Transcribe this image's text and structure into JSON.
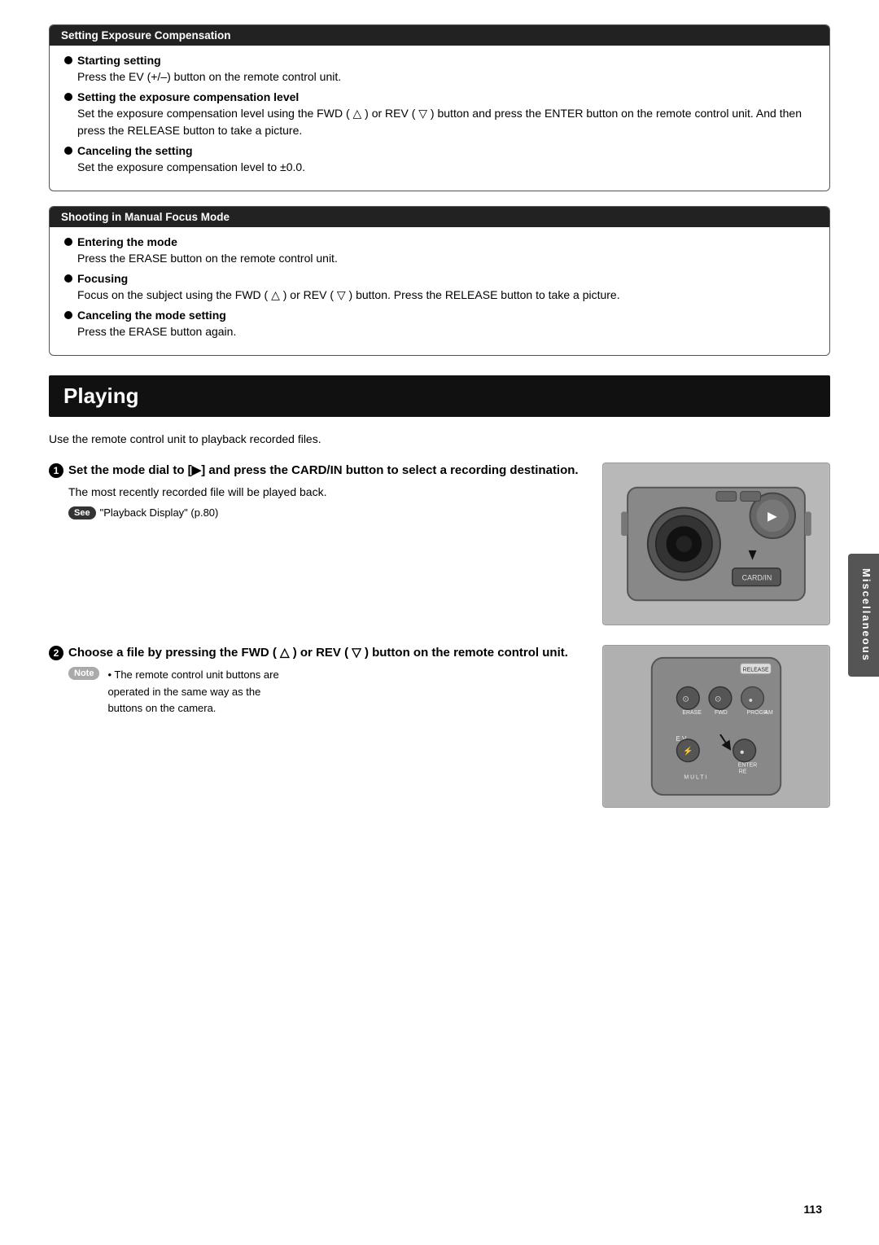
{
  "section1": {
    "title": "Setting Exposure Compensation",
    "bullets": [
      {
        "label": "Starting setting",
        "text": "Press the EV (+/–) button on the remote control unit."
      },
      {
        "label": "Setting the exposure compensation level",
        "text": "Set the exposure compensation level using the FWD ( △ ) or REV ( ▽ ) button and press the ENTER button on the remote control unit. And then press the RELEASE button to take a picture."
      },
      {
        "label": "Canceling the setting",
        "text": "Set the exposure compensation level to ±0.0."
      }
    ]
  },
  "section2": {
    "title": "Shooting in Manual Focus Mode",
    "bullets": [
      {
        "label": "Entering the mode",
        "text": "Press the ERASE button on the remote control unit."
      },
      {
        "label": "Focusing",
        "text": "Focus on the subject using the FWD ( △ ) or REV ( ▽ ) button.  Press the RELEASE button to take a picture."
      },
      {
        "label": "Canceling the mode setting",
        "text": "Press the ERASE button again."
      }
    ]
  },
  "playing": {
    "header": "Playing",
    "intro": "Use the remote control unit to playback recorded files.",
    "steps": [
      {
        "number": "1",
        "bold_text": "Set the mode dial to [▶] and press the CARD/IN button to select a recording destination.",
        "body_text": "The most recently recorded file will be played back.",
        "see_label": "See",
        "see_text": "\"Playback Display\" (p.80)"
      },
      {
        "number": "2",
        "bold_text": "Choose a file by pressing the FWD ( △ ) or REV ( ▽ ) button on the remote control unit.",
        "note_label": "Note",
        "note_bullets": [
          "The remote control unit buttons are operated in the same way as the buttons on the camera."
        ]
      }
    ]
  },
  "side_tab": "Miscellaneous",
  "page_number": "113"
}
